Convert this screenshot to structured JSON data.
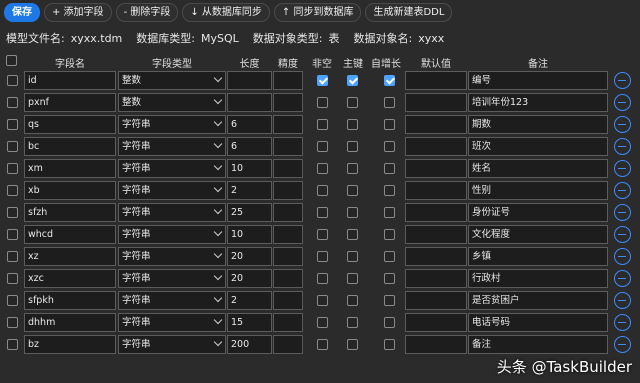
{
  "toolbar": {
    "save": "保存",
    "add_field": "+ 添加字段",
    "delete_field": "- 删除字段",
    "sync_from_db": "↓ 从数据库同步",
    "sync_to_db": "↑ 同步到数据库",
    "gen_ddl": "生成新建表DDL"
  },
  "meta": {
    "file_label": "模型文件名:",
    "file_value": "xyxx.tdm",
    "dbtype_label": "数据库类型:",
    "dbtype_value": "MySQL",
    "objtype_label": "数据对象类型:",
    "objtype_value": "表",
    "objname_label": "数据对象名:",
    "objname_value": "xyxx"
  },
  "columns": {
    "name": "字段名",
    "type": "字段类型",
    "length": "长度",
    "precision": "精度",
    "notnull": "非空",
    "pk": "主键",
    "autoinc": "自增长",
    "default": "默认值",
    "comment": "备注"
  },
  "rows": [
    {
      "name": "id",
      "type": "整数",
      "length": "",
      "precision": "",
      "notnull": true,
      "pk": true,
      "autoinc": true,
      "default": "",
      "comment": "编号"
    },
    {
      "name": "pxnf",
      "type": "整数",
      "length": "",
      "precision": "",
      "notnull": false,
      "pk": false,
      "autoinc": false,
      "default": "",
      "comment": "培训年份123"
    },
    {
      "name": "qs",
      "type": "字符串",
      "length": "6",
      "precision": "",
      "notnull": false,
      "pk": false,
      "autoinc": false,
      "default": "",
      "comment": "期数"
    },
    {
      "name": "bc",
      "type": "字符串",
      "length": "6",
      "precision": "",
      "notnull": false,
      "pk": false,
      "autoinc": false,
      "default": "",
      "comment": "班次"
    },
    {
      "name": "xm",
      "type": "字符串",
      "length": "10",
      "precision": "",
      "notnull": false,
      "pk": false,
      "autoinc": false,
      "default": "",
      "comment": "姓名"
    },
    {
      "name": "xb",
      "type": "字符串",
      "length": "2",
      "precision": "",
      "notnull": false,
      "pk": false,
      "autoinc": false,
      "default": "",
      "comment": "性别"
    },
    {
      "name": "sfzh",
      "type": "字符串",
      "length": "25",
      "precision": "",
      "notnull": false,
      "pk": false,
      "autoinc": false,
      "default": "",
      "comment": "身份证号"
    },
    {
      "name": "whcd",
      "type": "字符串",
      "length": "10",
      "precision": "",
      "notnull": false,
      "pk": false,
      "autoinc": false,
      "default": "",
      "comment": "文化程度"
    },
    {
      "name": "xz",
      "type": "字符串",
      "length": "20",
      "precision": "",
      "notnull": false,
      "pk": false,
      "autoinc": false,
      "default": "",
      "comment": "乡镇"
    },
    {
      "name": "xzc",
      "type": "字符串",
      "length": "20",
      "precision": "",
      "notnull": false,
      "pk": false,
      "autoinc": false,
      "default": "",
      "comment": "行政村"
    },
    {
      "name": "sfpkh",
      "type": "字符串",
      "length": "2",
      "precision": "",
      "notnull": false,
      "pk": false,
      "autoinc": false,
      "default": "",
      "comment": "是否贫困户"
    },
    {
      "name": "dhhm",
      "type": "字符串",
      "length": "15",
      "precision": "",
      "notnull": false,
      "pk": false,
      "autoinc": false,
      "default": "",
      "comment": "电话号码"
    },
    {
      "name": "bz",
      "type": "字符串",
      "length": "200",
      "precision": "",
      "notnull": false,
      "pk": false,
      "autoinc": false,
      "default": "",
      "comment": "备注"
    }
  ],
  "icons": {
    "remove": "minus-circle-icon",
    "caret": "chevron-down-icon"
  },
  "colors": {
    "accent": "#1e78e6",
    "background": "#2b2b2b"
  },
  "watermark": "头条 @TaskBuilder"
}
